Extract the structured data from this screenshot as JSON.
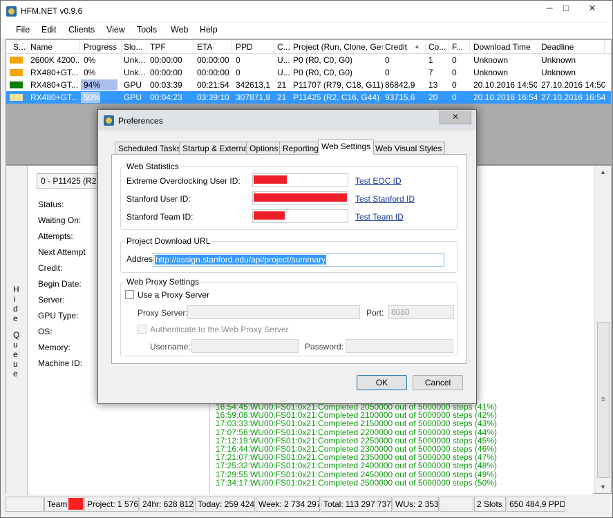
{
  "window": {
    "title": "HFM.NET v0.9.6",
    "minimize": "─",
    "maximize": "□",
    "close": "✕"
  },
  "menu": [
    "File",
    "Edit",
    "Clients",
    "View",
    "Tools",
    "Web",
    "Help"
  ],
  "grid": {
    "headers": [
      "S...",
      "Name",
      "Progress",
      "Slo...",
      "TPF",
      "ETA",
      "PPD",
      "C...",
      "Project (Run, Clone, Gen)",
      "Credit",
      "Co...",
      "F...",
      "Download Time",
      "Deadline"
    ],
    "sort_indicator": "▲",
    "rows": [
      {
        "status_color": "#f7a400",
        "name": "2600K 4200...",
        "progress": "0%",
        "progress_fraction": 0,
        "slot": "Unk...",
        "tpf": "00:00:00",
        "eta": "00:00:00",
        "ppd": "0",
        "c": "U...",
        "project": "P0 (R0, C0, G0)",
        "credit": "0",
        "co": "1",
        "f": "0",
        "download": "Unknown",
        "deadline": "Unknown"
      },
      {
        "status_color": "#f7a400",
        "name": "RX480+GT...",
        "progress": "0%",
        "progress_fraction": 0,
        "slot": "Unk...",
        "tpf": "00:00:00",
        "eta": "00:00:00",
        "ppd": "0",
        "c": "U...",
        "project": "P0 (R0, C0, G0)",
        "credit": "0",
        "co": "7",
        "f": "0",
        "download": "Unknown",
        "deadline": "Unknown"
      },
      {
        "status_color": "#0b7d0b",
        "name": "RX480+GT...",
        "progress": "94%",
        "progress_fraction": 0.94,
        "slot": "GPU",
        "tpf": "00:03:39",
        "eta": "00:21:54",
        "ppd": "342613,1",
        "c": "21",
        "project": "P11707 (R79, C18, G11)",
        "credit": "86842,9",
        "co": "13",
        "f": "0",
        "download": "20.10.2016 14:50",
        "deadline": "27.10.2016 14:50"
      },
      {
        "status_color": "#eee29a",
        "name": "RX480+GT...",
        "progress": "50%",
        "progress_fraction": 0.5,
        "slot": "GPU",
        "tpf": "00:04:23",
        "eta": "03:39:10",
        "ppd": "307871,8",
        "c": "21",
        "project": "P11425 (R2, C16, G44)",
        "credit": "93715,6",
        "co": "20",
        "f": "0",
        "download": "20.10.2016 16:54",
        "deadline": "27.10.2016 16:54"
      }
    ]
  },
  "queue": {
    "hide_label": [
      "H",
      "i",
      "d",
      "e",
      "Q",
      "u",
      "e",
      "u",
      "e"
    ],
    "selector": "0 - P11425 (R2, C"
  },
  "details": [
    "Status:",
    "Waiting On:",
    "Attempts:",
    "Next Attempt",
    "Credit:",
    "Begin Date:",
    "Server:",
    "GPU Type:",
    "OS:",
    "Memory:",
    "Machine ID:"
  ],
  "log": [
    "16:54:45:WU00:FS01:0x21:Completed 2050000 out of 5000000 steps (41%)",
    "16:59:08:WU00:FS01:0x21:Completed 2100000 out of 5000000 steps (42%)",
    "17:03:33:WU00:FS01:0x21:Completed 2150000 out of 5000000 steps (43%)",
    "17:07:56:WU00:FS01:0x21:Completed 2200000 out of 5000000 steps (44%)",
    "17:12:19:WU00:FS01:0x21:Completed 2250000 out of 5000000 steps (45%)",
    "17:16:44:WU00:FS01:0x21:Completed 2300000 out of 5000000 steps (46%)",
    "17:21:07:WU00:FS01:0x21:Completed 2350000 out of 5000000 steps (47%)",
    "17:25:32:WU00:FS01:0x21:Completed 2400000 out of 5000000 steps (48%)",
    "17:29:55:WU00:FS01:0x21:Completed 2450000 out of 5000000 steps (49%)",
    "17:34:17:WU00:FS01:0x21:Completed 2500000 out of 5000000 steps (50%)"
  ],
  "status": {
    "team": "Team",
    "team_color": "#ff1f1f",
    "project": "Project: 1 576",
    "day": "24hr: 628 812",
    "today": "Today: 259 424",
    "week": "Week: 2 734 297",
    "total": "Total: 113 297 737",
    "wus": "WUs: 2 353",
    "slots": "2 Slots",
    "ppd": "650 484,9 PPD"
  },
  "dialog": {
    "title": "Preferences",
    "close": "✕",
    "tabs": [
      "Scheduled Tasks",
      "Startup & External",
      "Options",
      "Reporting",
      "Web Settings",
      "Web Visual Styles"
    ],
    "active_tab": "Web Settings",
    "web_stats": {
      "title": "Web Statistics",
      "eoc_label": "Extreme Overclocking User ID:",
      "stanford_label": "Stanford User ID:",
      "team_label": "Stanford Team ID:",
      "test_eoc": "Test EOC ID",
      "test_stanford": "Test Stanford ID",
      "test_team": "Test Team ID",
      "redact_color": "#ee1f2b"
    },
    "download": {
      "title": "Project Download URL",
      "address_label": "Address:",
      "address": "http://assign.stanford.edu/api/project/summary"
    },
    "proxy": {
      "title": "Web Proxy Settings",
      "use_proxy": "Use a Proxy Server",
      "server_label": "Proxy Server:",
      "server_value": "",
      "port_label": "Port:",
      "port_value": "8080",
      "auth": "Authenticate to the Web Proxy Server",
      "username_label": "Username:",
      "password_label": "Password:"
    },
    "ok": "OK",
    "cancel": "Cancel"
  }
}
